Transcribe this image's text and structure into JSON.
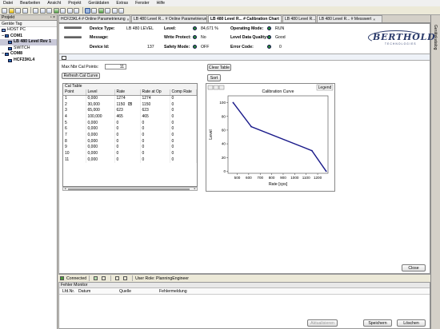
{
  "menu": [
    "Datei",
    "Bearbeiten",
    "Ansicht",
    "Projekt",
    "Gerätdaten",
    "Extras",
    "Fenster",
    "Hilfe"
  ],
  "project_panel": {
    "title": "Projekt",
    "subtitle": "Geräte Tag",
    "tree": [
      {
        "label": "HOST PC",
        "indent": 1,
        "icon": "pc-icon"
      },
      {
        "label": "COM1",
        "indent": 1,
        "icon": "port-icon"
      },
      {
        "label": "LB 480 Level Rev 1",
        "indent": 2,
        "icon": "device-icon",
        "selected": true
      },
      {
        "label": "SWITCH",
        "indent": 2,
        "icon": "device-icon"
      },
      {
        "label": "COM8",
        "indent": 1,
        "icon": "port-icon"
      },
      {
        "label": "HCF23KL4",
        "indent": 2,
        "icon": "device-icon"
      }
    ]
  },
  "tabs": [
    {
      "label": "HCF23KL4 # Online Parametrierung",
      "active": false
    },
    {
      "label": "LB 480 Level R... # Online Parametrierung",
      "active": false
    },
    {
      "label": "LB 480 Level R... # Calibration Chart",
      "active": true
    },
    {
      "label": "LB 480 Level R...",
      "active": false
    },
    {
      "label": "LB 480 Level R... # Messwert",
      "active": false
    }
  ],
  "device_info": {
    "device_type_label": "Device Type:",
    "device_type": "LB 480 LEVEL",
    "message_label": "Message:",
    "message": "",
    "device_id_label": "Device Id:",
    "device_id": "137",
    "level_label": "Level:",
    "level": "84,671 %",
    "write_protect_label": "Write Protect:",
    "write_protect": "No",
    "safety_mode_label": "Safety Mode:",
    "safety_mode": "OFF",
    "operating_mode_label": "Operating Mode:",
    "operating_mode": "RUN",
    "level_quality_label": "Level Data Quality:",
    "level_quality": "Good",
    "error_code_label": "Error Code:",
    "error_code": "0"
  },
  "brand": {
    "name": "BERTHOLD",
    "sub": "TECHNOLOGIES"
  },
  "calibration": {
    "max_points_label": "Max Nbr Cal Points:",
    "max_points": "11",
    "refresh_label": "Refresh Cal Curve",
    "clear_label": "Clear Table",
    "sort_label": "Sort",
    "table_title": "Cal Table",
    "columns": [
      "Point",
      "Level",
      "Rate",
      "Rate at Op",
      "Comp Rate"
    ],
    "rows": [
      [
        "1",
        "0,000",
        "1274",
        "1274",
        "0"
      ],
      [
        "2",
        "30,000",
        "1150",
        "1150",
        "0"
      ],
      [
        "3",
        "65,000",
        "623",
        "623",
        "0"
      ],
      [
        "4",
        "100,000",
        "465",
        "465",
        "0"
      ],
      [
        "5",
        "0,000",
        "0",
        "0",
        "0"
      ],
      [
        "6",
        "0,000",
        "0",
        "0",
        "0"
      ],
      [
        "7",
        "0,000",
        "0",
        "0",
        "0"
      ],
      [
        "8",
        "0,000",
        "0",
        "0",
        "0"
      ],
      [
        "9",
        "0,000",
        "0",
        "0",
        "0"
      ],
      [
        "10",
        "0,000",
        "0",
        "0",
        "0"
      ],
      [
        "11",
        "0,000",
        "0",
        "0",
        "0"
      ]
    ]
  },
  "chart_data": {
    "type": "line",
    "title": "Calibration Curve",
    "xlabel": "Rate [cps]",
    "ylabel": "Level",
    "legend_label": "Legend",
    "x": [
      465,
      623,
      1150,
      1274
    ],
    "y": [
      100,
      65,
      30,
      0
    ],
    "xlim": [
      420,
      1290
    ],
    "ylim": [
      -3,
      110
    ],
    "xticks": [
      500,
      600,
      700,
      800,
      900,
      1000,
      1100,
      1200
    ],
    "yticks": [
      0,
      20,
      40,
      60,
      80,
      100
    ],
    "color": "#1a1a8a",
    "grid": false
  },
  "close_label": "Close",
  "right_strip_label": "Gerätekatalog",
  "status_bar": {
    "connected": "Connected",
    "user_role": "User Role: PlanningEngineer"
  },
  "monitor": {
    "title": "Fehler Monitor",
    "columns": [
      "Lfd.Nr.",
      "Datum",
      "Quelle",
      "Fehlermeldung"
    ],
    "buttons": {
      "refresh": "Aktualisieren",
      "save": "Speichern",
      "delete": "Löschen"
    }
  }
}
